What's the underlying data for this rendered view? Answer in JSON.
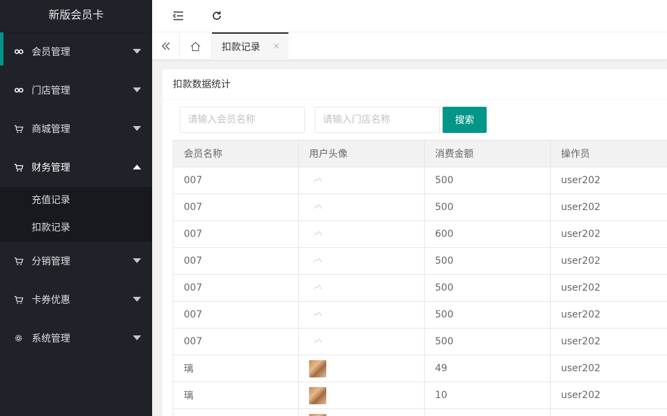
{
  "app": {
    "title": "新版会员卡"
  },
  "sidebar": {
    "items": [
      {
        "label": "会员管理",
        "icon": "link-icon",
        "active": true
      },
      {
        "label": "门店管理",
        "icon": "link-icon"
      },
      {
        "label": "商城管理",
        "icon": "cart-icon"
      },
      {
        "label": "财务管理",
        "icon": "cart-icon",
        "open": true,
        "children": [
          {
            "label": "充值记录"
          },
          {
            "label": "扣款记录"
          }
        ]
      },
      {
        "label": "分销管理",
        "icon": "cart-icon"
      },
      {
        "label": "卡券优惠",
        "icon": "cart-icon"
      },
      {
        "label": "系统管理",
        "icon": "gear-icon"
      }
    ]
  },
  "topbar": {
    "collapse_icon": "shrink-menu-icon",
    "refresh_icon": "refresh-icon"
  },
  "tabs": {
    "active": {
      "label": "扣款记录",
      "close": "×"
    }
  },
  "card": {
    "title": "扣款数据统计",
    "search": {
      "member_placeholder": "请输入会员名称",
      "store_placeholder": "请输入门店名称",
      "button_label": "搜索"
    }
  },
  "table": {
    "headers": [
      "会员名称",
      "用户头像",
      "消费金额",
      "操作员"
    ],
    "rows": [
      {
        "name": "007",
        "avatar": "broken",
        "amount": "500",
        "operator": "user202"
      },
      {
        "name": "007",
        "avatar": "broken",
        "amount": "500",
        "operator": "user202"
      },
      {
        "name": "007",
        "avatar": "broken",
        "amount": "600",
        "operator": "user202"
      },
      {
        "name": "007",
        "avatar": "broken",
        "amount": "500",
        "operator": "user202"
      },
      {
        "name": "007",
        "avatar": "broken",
        "amount": "500",
        "operator": "user202"
      },
      {
        "name": "007",
        "avatar": "broken",
        "amount": "500",
        "operator": "user202"
      },
      {
        "name": "007",
        "avatar": "broken",
        "amount": "500",
        "operator": "user202"
      },
      {
        "name": "璃",
        "avatar": "photo",
        "amount": "49",
        "operator": "user202"
      },
      {
        "name": "璃",
        "avatar": "photo",
        "amount": "10",
        "operator": "user202"
      },
      {
        "name": "",
        "avatar": "photo",
        "amount": "",
        "operator": ""
      }
    ]
  },
  "colors": {
    "accent": "#009688",
    "sidebar_bg": "#20222a",
    "submenu_bg": "#18191f"
  }
}
